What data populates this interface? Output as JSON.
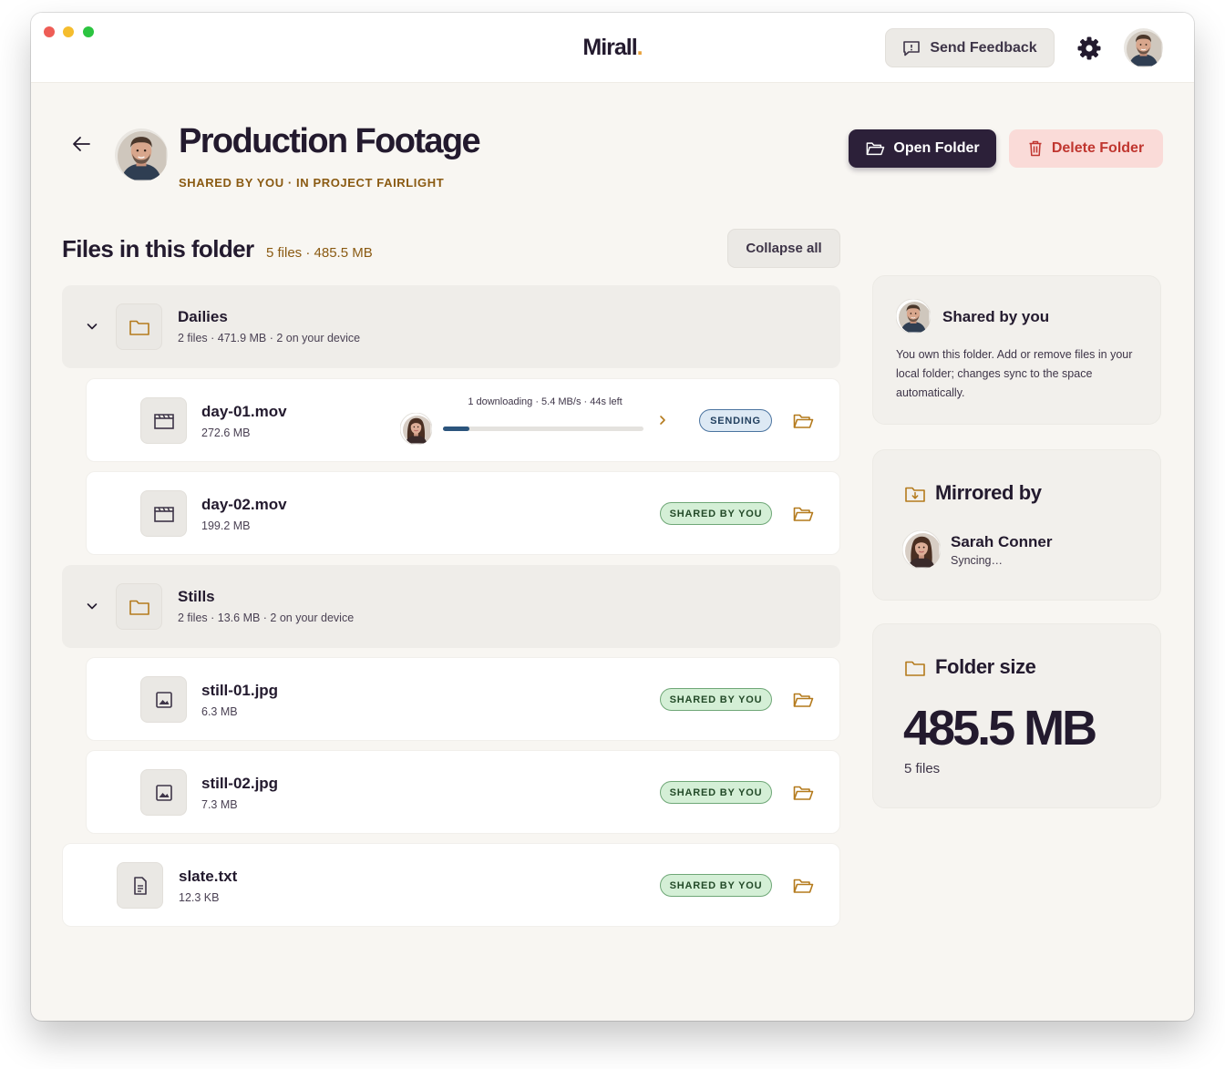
{
  "app": {
    "logo": "Mirall",
    "logo_dot": "."
  },
  "titlebar": {
    "feedback_label": "Send Feedback"
  },
  "header": {
    "title": "Production Footage",
    "subtitle": "SHARED BY YOU · IN PROJECT FAIRLIGHT",
    "open_folder_label": "Open Folder",
    "delete_folder_label": "Delete Folder"
  },
  "files": {
    "heading": "Files in this folder",
    "meta": "5 files · 485.5 MB",
    "collapse_label": "Collapse all",
    "groups": [
      {
        "name": "Dailies",
        "sub": "2 files · 471.9 MB · 2 on your device",
        "items": [
          {
            "name": "day-01.mov",
            "size": "272.6 MB",
            "badge": "SENDING",
            "download": {
              "text": "1 downloading · 5.4 MB/s · 44s left",
              "progress": 0.13
            }
          },
          {
            "name": "day-02.mov",
            "size": "199.2 MB",
            "badge": "SHARED BY YOU"
          }
        ]
      },
      {
        "name": "Stills",
        "sub": "2 files · 13.6 MB · 2 on your device",
        "items": [
          {
            "name": "still-01.jpg",
            "size": "6.3 MB",
            "badge": "SHARED BY YOU"
          },
          {
            "name": "still-02.jpg",
            "size": "7.3 MB",
            "badge": "SHARED BY YOU"
          }
        ]
      }
    ],
    "loose": [
      {
        "name": "slate.txt",
        "size": "12.3 KB",
        "badge": "SHARED BY YOU"
      }
    ]
  },
  "sidebar": {
    "shared": {
      "title": "Shared by you",
      "text": "You own this folder. Add or remove files in your local folder; changes sync to the space automatically."
    },
    "mirrored": {
      "title": "Mirrored by",
      "name": "Sarah Conner",
      "status": "Syncing…"
    },
    "size": {
      "title": "Folder size",
      "value": "485.5 MB",
      "files": "5 files"
    }
  },
  "colors": {
    "accent_dark": "#2c2039",
    "accent_gold": "#8a5a12",
    "danger": "#c0362f",
    "shared_badge": "#d4efd6",
    "sending_badge": "#dde9f4",
    "progress": "#2c557d"
  },
  "icons": {
    "gear": "gear-icon",
    "feedback": "message-icon",
    "back": "arrow-left-icon",
    "folder": "folder-icon",
    "video": "clapperboard-icon",
    "image": "image-icon",
    "text": "document-icon",
    "trash": "trash-icon",
    "download_folder": "folder-download-icon"
  }
}
